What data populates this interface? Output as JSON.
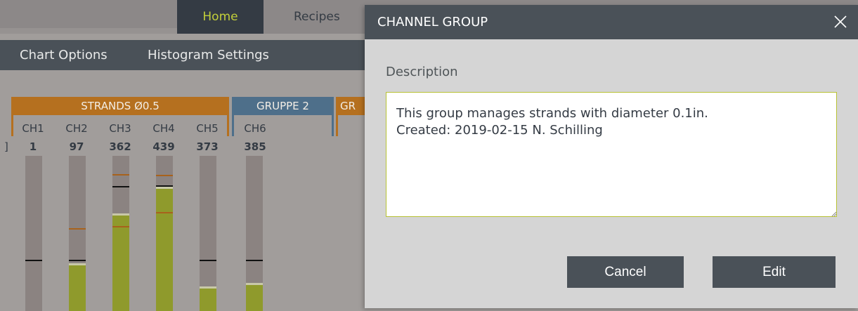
{
  "nav": {
    "home_label": "Home",
    "recipes_label": "Recipes"
  },
  "menu": {
    "chart_options": "Chart Options",
    "histogram_settings": "Histogram Settings"
  },
  "groups": [
    {
      "name": "STRANDS Ø0.5",
      "color": "#b5701f"
    },
    {
      "name": "GRUPPE 2",
      "color": "#4e6f8a"
    },
    {
      "name": "GR",
      "color": "#b5701f"
    }
  ],
  "channels": [
    {
      "label": "CH1",
      "value": "1",
      "fill": 0.0
    },
    {
      "label": "CH2",
      "value": "97",
      "fill": 0.31
    },
    {
      "label": "CH3",
      "value": "362",
      "fill": 0.63
    },
    {
      "label": "CH4",
      "value": "439",
      "fill": 0.8
    },
    {
      "label": "CH5",
      "value": "373",
      "fill": 0.16
    },
    {
      "label": "CH6",
      "value": "385",
      "fill": 0.18
    }
  ],
  "dialog": {
    "title": "CHANNEL GROUP",
    "close_icon": "close-icon",
    "description_label": "Description",
    "description_value": "This group manages strands with diameter 0.1in.\nCreated: 2019-02-15 N. Schilling",
    "cancel_label": "Cancel",
    "edit_label": "Edit"
  },
  "colors": {
    "accent": "#c2cf3a",
    "dark": "#4a5158",
    "bar_fill": "#8f9a2c",
    "bar_track": "#8b8381"
  }
}
